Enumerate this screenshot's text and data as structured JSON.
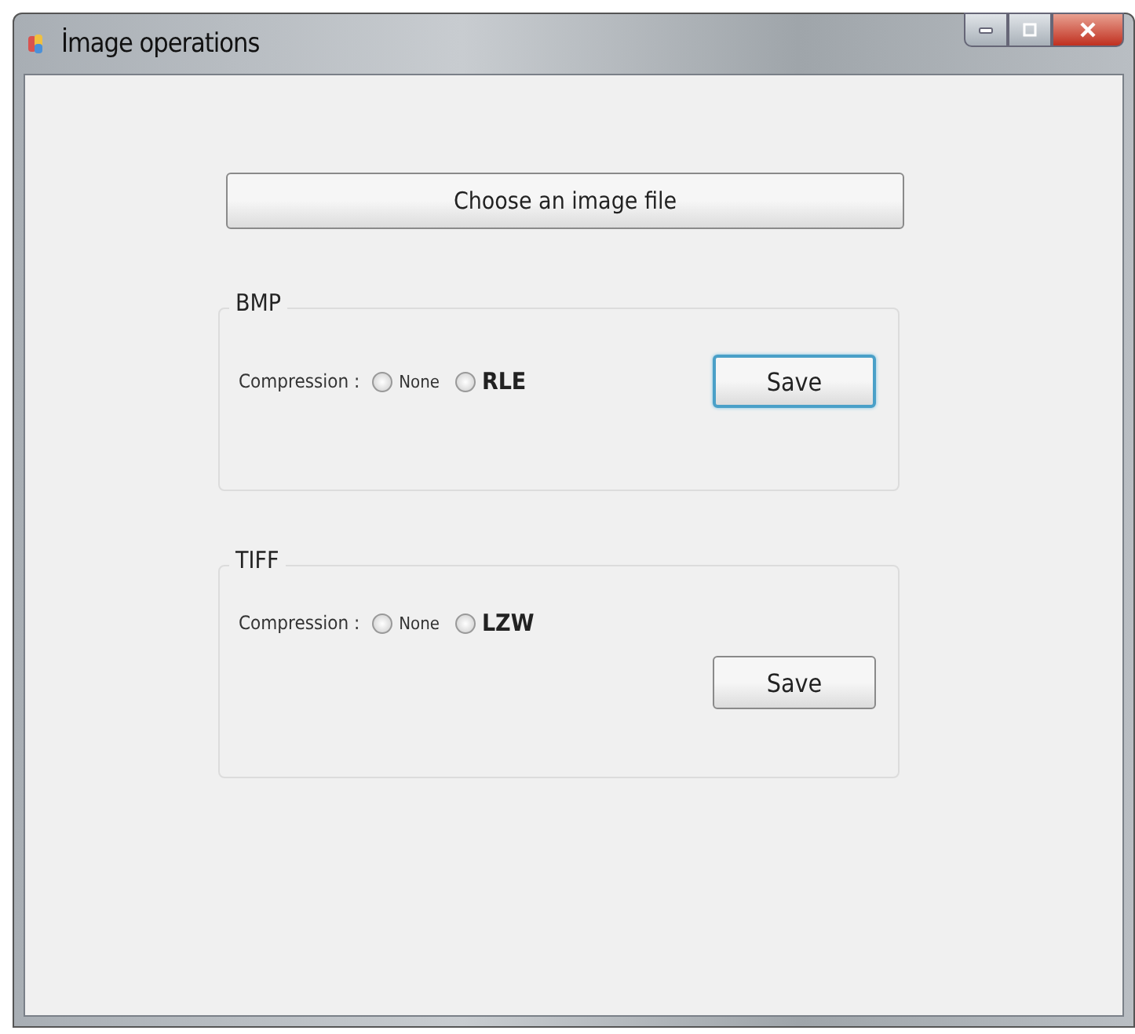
{
  "window": {
    "title": "İmage operations"
  },
  "choose_button": "Choose an image file",
  "groups": [
    {
      "title": "BMP",
      "label": "Compression :",
      "options": [
        {
          "label": "None",
          "selected": false
        },
        {
          "label": "RLE",
          "selected": false
        }
      ],
      "save": {
        "label": "Save",
        "focused": true
      },
      "kind": "inline"
    },
    {
      "title": "TIFF",
      "label": "Compression :",
      "options": [
        {
          "label": "None",
          "selected": false
        },
        {
          "label": "LZW",
          "selected": false
        }
      ],
      "save": {
        "label": "Save",
        "focused": false
      },
      "kind": "stacked"
    }
  ]
}
